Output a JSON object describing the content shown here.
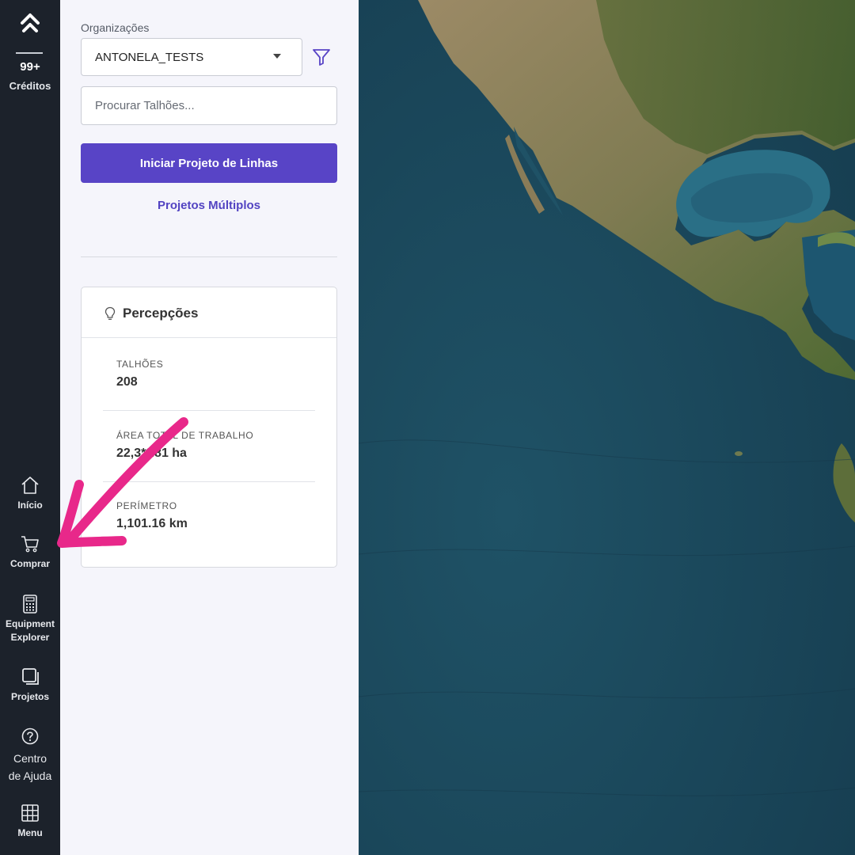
{
  "rail": {
    "credits_count": "99+",
    "credits_label": "Créditos",
    "items": [
      {
        "label": "Início",
        "icon": "home-icon"
      },
      {
        "label": "Comprar",
        "icon": "cart-icon"
      },
      {
        "label": "Equipment\nExplorer",
        "icon": "calculator-icon"
      },
      {
        "label": "Projetos",
        "icon": "projects-icon"
      },
      {
        "label": "Centro\nde Ajuda",
        "icon": "help-icon"
      },
      {
        "label": "Menu",
        "icon": "grid-icon"
      }
    ]
  },
  "panel": {
    "org_label": "Organizações",
    "org_value": "ANTONELA_TESTS",
    "search_placeholder": "Procurar Talhões...",
    "primary_button": "Iniciar Projeto de Linhas",
    "link": "Projetos Múltiplos"
  },
  "insights": {
    "title": "Percepções",
    "stats": [
      {
        "key": "TALHÕES",
        "value": "208"
      },
      {
        "key": "ÁREA TOTAL DE TRABALHO",
        "value": "22,3**.81 ha"
      },
      {
        "key": "PERÍMETRO",
        "value": "1,101.16 km"
      }
    ]
  },
  "colors": {
    "rail_bg": "#1c222b",
    "accent": "#5844c6",
    "annotation_arrow": "#e8288a",
    "ocean": "#1c4a5e"
  }
}
